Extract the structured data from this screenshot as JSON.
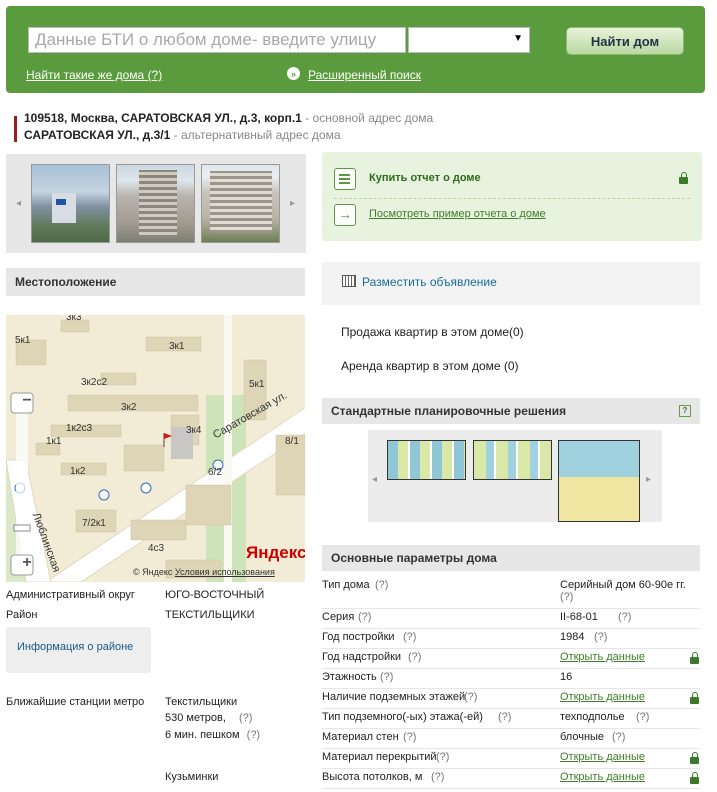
{
  "header": {
    "search_placeholder": "Данные БТИ о любом доме- введите улицу",
    "select_value": "",
    "find_button": "Найти дом",
    "same_houses_link": "Найти такие же дома",
    "same_houses_help": "(?)",
    "advanced_search": "Расширенный поиск"
  },
  "address": {
    "main_address": "109518, Москва, САРАТОВСКАЯ УЛ., д.3, корп.1",
    "main_note": " - основной адрес дома",
    "alt_address": "САРАТОВСКАЯ УЛ., д.3/1",
    "alt_note": " - альтернативный адрес дома"
  },
  "location": {
    "title": "Местоположение",
    "map": {
      "labels": [
        "3к3",
        "5к1",
        "3к1",
        "3к2с2",
        "3к2",
        "1к2с3",
        "1к1",
        "1к2",
        "3к4",
        "5к1",
        "8/1",
        "6/2",
        "7/2к1",
        "4с3",
        "Саратовская ул.",
        "Люблинская"
      ],
      "copyright": "© Яндекс",
      "terms": "Условия использования",
      "brand": "Яндекс",
      "zoom_in": "+",
      "zoom_out": "−"
    }
  },
  "left_params": {
    "okrug_label": "Административный округ",
    "okrug_value": "ЮГО-ВОСТОЧНЫЙ",
    "rayon_label": "Район",
    "rayon_value": "ТЕКСТИЛЬЩИКИ",
    "district_info_link": "Информация о районе",
    "metro_label": "Ближайшие станции метро",
    "metro": [
      {
        "name": "Текстильщики",
        "distance": "530 метров,",
        "walk": "6 мин. пешком",
        "help": "(?)"
      },
      {
        "name": "Кузьминки",
        "distance": "",
        "walk": "",
        "help": ""
      }
    ]
  },
  "report": {
    "buy_link": "Купить отчет о доме",
    "sample_link": "Посмотреть пример отчета о доме"
  },
  "ad": {
    "place_ad": "Разместить объявление",
    "sale": "Продажа квартир в этом доме(0)",
    "rent": "Аренда квартир в этом доме (0)"
  },
  "plans": {
    "title": "Стандартные планировочные решения",
    "help": "?"
  },
  "house_params": {
    "title": "Основные параметры дома",
    "rows": [
      {
        "label": "Тип дома",
        "value": "Серийный дом 60-90е гг.",
        "value_help": "(?)",
        "locked": false
      },
      {
        "label": "Серия",
        "value": "II-68-01",
        "value_help": "(?)",
        "locked": false
      },
      {
        "label": "Год постройки",
        "value": "1984",
        "value_help": "(?)",
        "locked": false
      },
      {
        "label": "Год надстройки",
        "value": "Открыть данные",
        "value_help": "",
        "locked": true
      },
      {
        "label": "Этажность",
        "value": "16",
        "value_help": "",
        "locked": false
      },
      {
        "label": "Наличие подземных этажей",
        "value": "Открыть данные",
        "value_help": "",
        "locked": true
      },
      {
        "label": "Тип подземного(-ых) этажа(-ей)",
        "value": "техподполье",
        "value_help": "(?)",
        "locked": false
      },
      {
        "label": "Материал стен",
        "value": "блочные",
        "value_help": "(?)",
        "locked": false
      },
      {
        "label": "Материал перекрытий",
        "value": "Открыть данные",
        "value_help": "",
        "locked": true
      },
      {
        "label": "Высота потолков, м",
        "value": "Открыть данные",
        "value_help": "",
        "locked": true
      }
    ],
    "help": "(?)"
  }
}
